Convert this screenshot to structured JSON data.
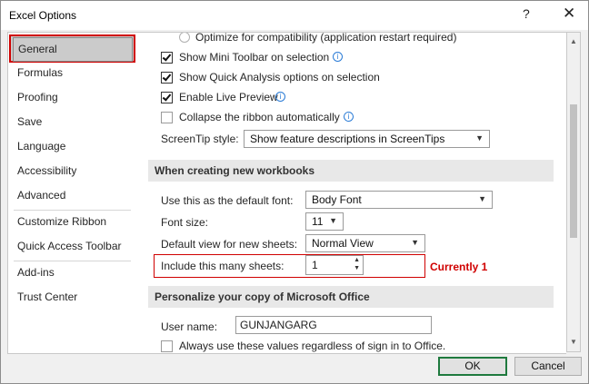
{
  "window": {
    "title": "Excel Options",
    "help": "?",
    "close": "✕"
  },
  "sidebar": {
    "items": [
      {
        "label": "General",
        "selected": true
      },
      {
        "label": "Formulas"
      },
      {
        "label": "Proofing"
      },
      {
        "label": "Save"
      },
      {
        "label": "Language"
      },
      {
        "label": "Accessibility"
      },
      {
        "label": "Advanced"
      },
      {
        "label": "Customize Ribbon"
      },
      {
        "label": "Quick Access Toolbar"
      },
      {
        "label": "Add-ins"
      },
      {
        "label": "Trust Center"
      }
    ]
  },
  "ui_options": {
    "optimize_compat": "Optimize for compatibility (application restart required)",
    "mini_toolbar": "Show Mini Toolbar on selection",
    "quick_analysis": "Show Quick Analysis options on selection",
    "live_preview": "Enable Live Preview",
    "collapse_ribbon": "Collapse the ribbon automatically",
    "screentip_label": "ScreenTip style:",
    "screentip_value": "Show feature descriptions in ScreenTips"
  },
  "new_workbooks": {
    "heading": "When creating new workbooks",
    "font_label": "Use this as the default font:",
    "font_value": "Body Font",
    "size_label": "Font size:",
    "size_value": "11",
    "view_label": "Default view for new sheets:",
    "view_value": "Normal View",
    "sheets_label": "Include this many sheets:",
    "sheets_value": "1"
  },
  "annotation": {
    "note": "Currently 1",
    "color": "#d00000"
  },
  "personalize": {
    "heading": "Personalize your copy of Microsoft Office",
    "username_label": "User name:",
    "username_value": "GUNJANGARG",
    "always_use": "Always use these values regardless of sign in to Office."
  },
  "buttons": {
    "ok": "OK",
    "cancel": "Cancel"
  },
  "colors": {
    "ok_border": "#1f7a3e",
    "highlight": "#d00000"
  }
}
